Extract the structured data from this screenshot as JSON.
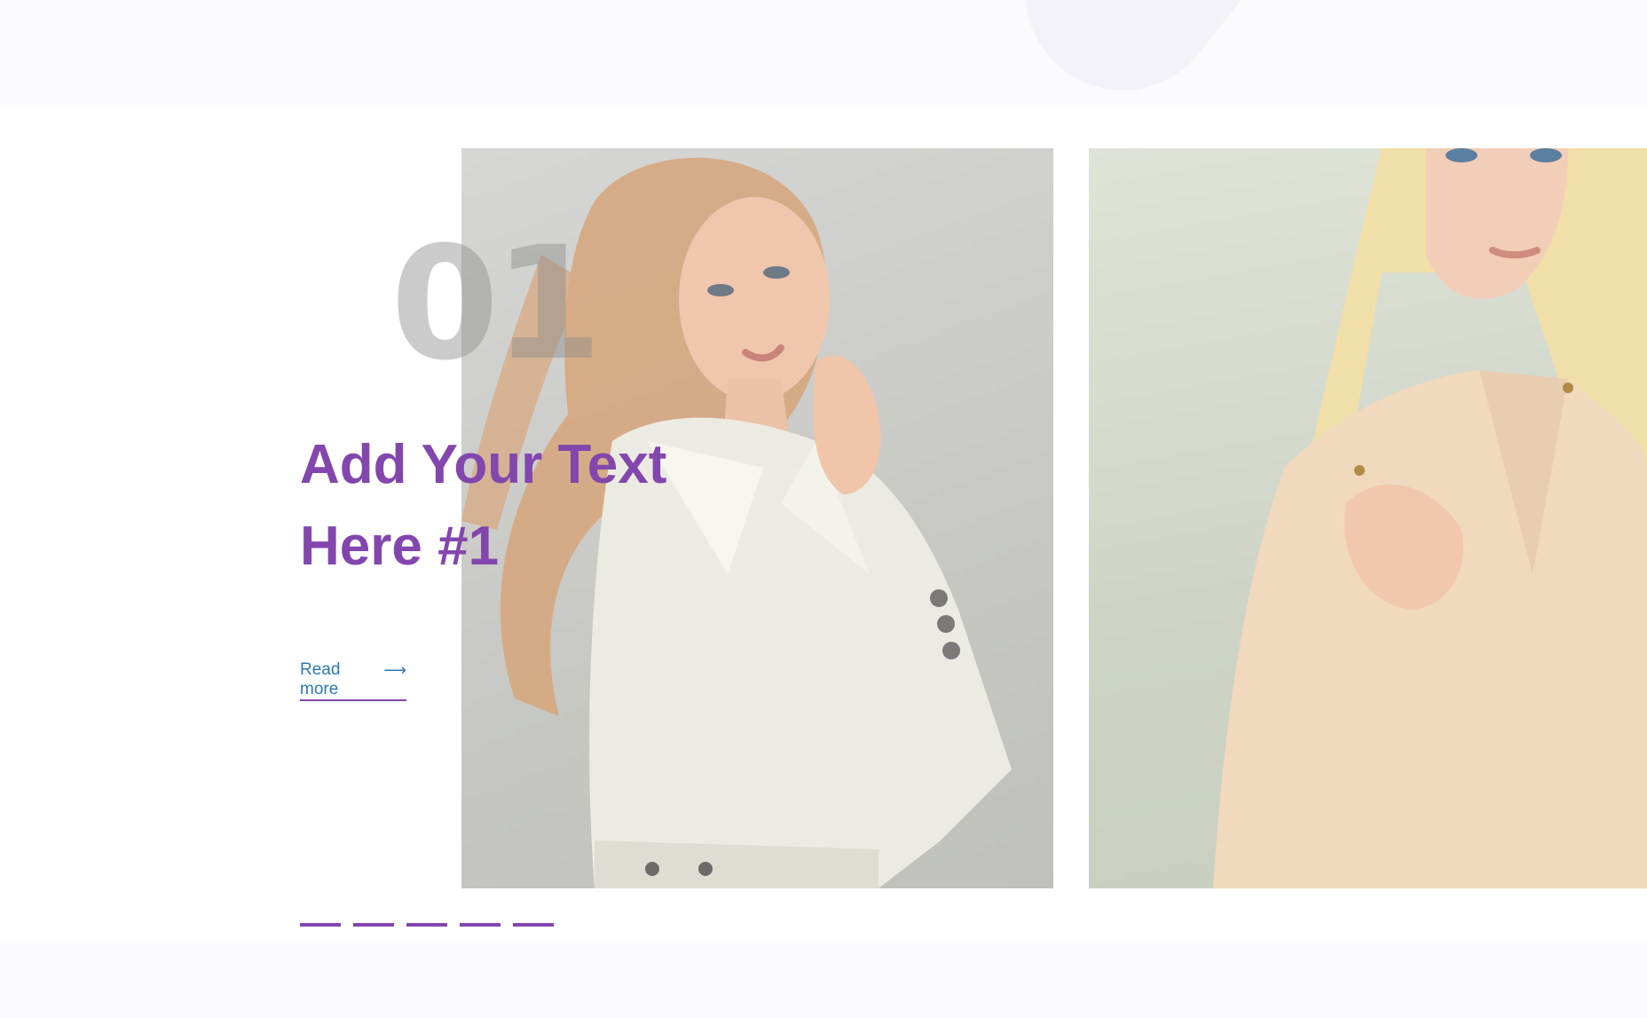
{
  "slide": {
    "number": "01",
    "title": "Add Your Text Here #1",
    "read_more_label": "Read more",
    "arrow_glyph": "⟶"
  },
  "pagination": {
    "count": 5,
    "active_index": 0
  },
  "images": [
    {
      "name": "model-white-trench-coat",
      "description_icon": "photo"
    },
    {
      "name": "model-beige-quilted-jacket",
      "description_icon": "photo"
    }
  ],
  "colors": {
    "accent": "#8346ad",
    "link": "#2c78b4",
    "number": "#8c8c8c"
  }
}
